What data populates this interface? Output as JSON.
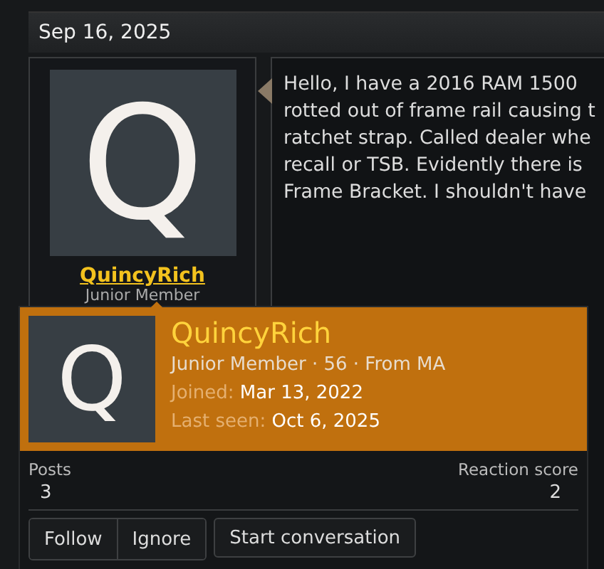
{
  "post": {
    "date": "Sep 16, 2025",
    "author": {
      "avatar_letter": "Q",
      "username": "QuincyRich",
      "title": "Junior Member"
    }
  },
  "message_lines": [
    "Hello, I have a 2016 RAM 1500",
    "rotted out of frame rail causing t",
    "ratchet strap. Called dealer whe",
    "recall or TSB. Evidently there is",
    "Frame Bracket. I shouldn't have"
  ],
  "member_card": {
    "avatar_letter": "Q",
    "username": "QuincyRich",
    "blurb": "Junior Member · 56 · From MA",
    "facts": [
      {
        "label": "Joined:",
        "value": "Mar 13, 2022"
      },
      {
        "label": "Last seen:",
        "value": "Oct 6, 2025"
      }
    ],
    "stats": [
      {
        "label": "Posts",
        "value": "3"
      },
      {
        "label": "Reaction score",
        "value": "2"
      }
    ],
    "buttons": [
      {
        "label": "Follow",
        "group": true
      },
      {
        "label": "Ignore",
        "group": true
      },
      {
        "label": "Start conversation",
        "group": false
      }
    ]
  }
}
